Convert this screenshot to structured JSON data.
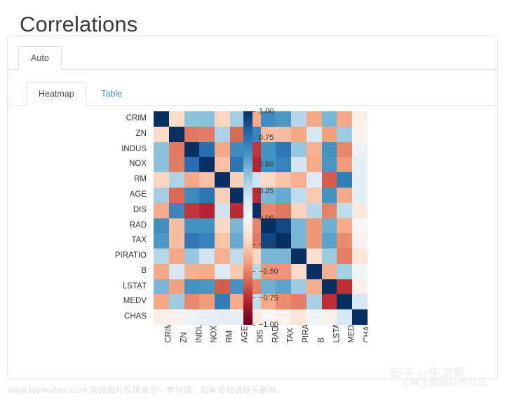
{
  "page": {
    "title": "Correlations"
  },
  "tabs_outer": [
    {
      "label": "Auto",
      "active": true
    }
  ],
  "tabs_inner": [
    {
      "label": "Heatmap",
      "active": true
    },
    {
      "label": "Table",
      "active": false
    }
  ],
  "watermarks": {
    "bottom": "www.toymoban.com 网络图片仅供展示，非存储，如有侵权请联系删除。",
    "zhihu": "知乎 @朱卫军",
    "juejin": "@稀土掘金技术社区"
  },
  "colors": {
    "accent_link": "#4a90c4",
    "cmap_high": "#053061",
    "cmap_mid": "#f7f7f7",
    "cmap_low": "#67001f",
    "text": "#333333",
    "card_border": "#e6e6e6"
  },
  "chart_data": {
    "type": "heatmap",
    "title": "Correlations",
    "xlabel": "",
    "ylabel": "",
    "grid": false,
    "legend_position": "right",
    "colormap": "RdBu",
    "zlim": [
      -1.0,
      1.0
    ],
    "colorbar_ticks": [
      1.0,
      0.75,
      0.5,
      0.25,
      0.0,
      -0.25,
      -0.5,
      -0.75,
      -1.0
    ],
    "colorbar_tick_labels": [
      "1.00",
      "0.75",
      "0.50",
      "0.25",
      "0.00",
      "−0.25",
      "−0.50",
      "−0.75",
      "−1.00"
    ],
    "x_tick_labels": [
      "CRIM",
      "ZN",
      "INDUS",
      "NOX",
      "RM",
      "AGE",
      "DIS",
      "RAD",
      "TAX",
      "PIRATIO",
      "B",
      "LSTAT",
      "MEDV",
      "CHAS"
    ],
    "y_tick_labels": [
      "CRIM",
      "ZN",
      "INDUS",
      "NOX",
      "RM",
      "AGE",
      "DIS",
      "RAD",
      "TAX",
      "PIRATIO",
      "B",
      "LSTAT",
      "MEDV",
      "CHAS"
    ],
    "categories": [
      "CRIM",
      "ZN",
      "INDUS",
      "NOX",
      "RM",
      "AGE",
      "DIS",
      "RAD",
      "TAX",
      "PIRATIO",
      "B",
      "LSTAT",
      "MEDV",
      "CHAS"
    ],
    "values": [
      [
        1.0,
        -0.2,
        0.41,
        0.42,
        -0.22,
        0.35,
        -0.38,
        0.63,
        0.58,
        0.29,
        -0.39,
        0.46,
        -0.39,
        -0.06
      ],
      [
        -0.2,
        1.0,
        -0.53,
        -0.52,
        0.31,
        -0.57,
        0.66,
        -0.31,
        -0.31,
        -0.39,
        0.18,
        -0.41,
        0.36,
        -0.04
      ],
      [
        0.41,
        -0.53,
        1.0,
        0.76,
        -0.39,
        0.64,
        -0.71,
        0.6,
        0.72,
        0.38,
        -0.36,
        0.6,
        -0.48,
        0.06
      ],
      [
        0.42,
        -0.52,
        0.76,
        1.0,
        -0.3,
        0.73,
        -0.77,
        0.61,
        0.67,
        0.19,
        -0.38,
        0.59,
        -0.43,
        0.09
      ],
      [
        -0.22,
        0.31,
        -0.39,
        -0.3,
        1.0,
        -0.24,
        0.21,
        -0.21,
        -0.29,
        -0.36,
        0.13,
        -0.61,
        0.7,
        0.09
      ],
      [
        0.35,
        -0.57,
        0.64,
        0.73,
        -0.24,
        1.0,
        -0.75,
        0.46,
        0.51,
        0.26,
        -0.27,
        0.6,
        -0.38,
        0.09
      ],
      [
        -0.38,
        0.66,
        -0.71,
        -0.77,
        0.21,
        -0.75,
        1.0,
        -0.49,
        -0.53,
        -0.23,
        0.29,
        -0.5,
        0.25,
        -0.1
      ],
      [
        0.63,
        -0.31,
        0.6,
        0.61,
        -0.21,
        0.46,
        -0.49,
        1.0,
        0.91,
        0.46,
        -0.44,
        0.49,
        -0.38,
        -0.01
      ],
      [
        0.58,
        -0.31,
        0.72,
        0.67,
        -0.29,
        0.51,
        -0.53,
        0.91,
        1.0,
        0.46,
        -0.44,
        0.54,
        -0.47,
        -0.04
      ],
      [
        0.29,
        -0.39,
        0.38,
        0.19,
        -0.36,
        0.26,
        -0.23,
        0.46,
        0.46,
        1.0,
        -0.18,
        0.37,
        -0.51,
        -0.12
      ],
      [
        -0.39,
        0.18,
        -0.36,
        -0.38,
        0.13,
        -0.27,
        0.29,
        -0.44,
        -0.44,
        -0.18,
        1.0,
        -0.37,
        0.33,
        0.05
      ],
      [
        0.46,
        -0.41,
        0.6,
        0.59,
        -0.61,
        0.6,
        -0.5,
        0.49,
        0.54,
        0.37,
        -0.37,
        1.0,
        -0.74,
        -0.05
      ],
      [
        -0.39,
        0.36,
        -0.48,
        -0.43,
        0.7,
        -0.38,
        0.25,
        -0.38,
        -0.47,
        -0.51,
        0.33,
        -0.74,
        1.0,
        0.18
      ],
      [
        -0.06,
        -0.04,
        0.06,
        0.09,
        0.09,
        0.09,
        -0.1,
        -0.01,
        -0.04,
        -0.12,
        0.05,
        -0.05,
        0.18,
        1.0
      ]
    ]
  }
}
